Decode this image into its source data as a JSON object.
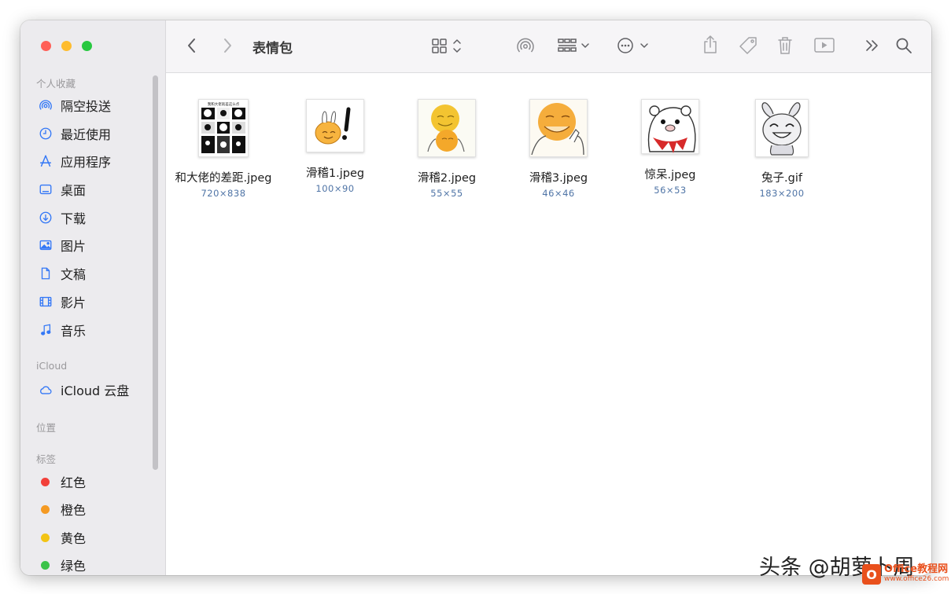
{
  "window": {
    "title": "表情包"
  },
  "colors": {
    "close": "#ff5f57",
    "minimize": "#febc2e",
    "zoom": "#28c840",
    "accent": "#3478f6"
  },
  "sidebar": {
    "favorites_title": "个人收藏",
    "favorites": [
      {
        "label": "隔空投送",
        "icon": "airdrop-icon"
      },
      {
        "label": "最近使用",
        "icon": "clock-icon"
      },
      {
        "label": "应用程序",
        "icon": "applications-icon"
      },
      {
        "label": "桌面",
        "icon": "desktop-icon"
      },
      {
        "label": "下载",
        "icon": "download-icon"
      },
      {
        "label": "图片",
        "icon": "photo-icon"
      },
      {
        "label": "文稿",
        "icon": "document-icon"
      },
      {
        "label": "影片",
        "icon": "film-icon"
      },
      {
        "label": "音乐",
        "icon": "music-icon"
      }
    ],
    "icloud_title": "iCloud",
    "icloud": [
      {
        "label": "iCloud 云盘",
        "icon": "cloud-icon"
      }
    ],
    "locations_title": "位置",
    "tags_title": "标签",
    "tags": [
      {
        "label": "红色",
        "color": "#f2403a"
      },
      {
        "label": "橙色",
        "color": "#f59a23"
      },
      {
        "label": "黄色",
        "color": "#f3c414"
      },
      {
        "label": "绿色",
        "color": "#3cc34a"
      }
    ]
  },
  "toolbar": {
    "back_icon": "chevron-left-icon",
    "forward_icon": "chevron-right-icon",
    "view_icon": "grid-view-icon",
    "airdrop_icon": "airdrop-icon",
    "group_icon": "group-icon",
    "more_icon": "ellipsis-circle-icon",
    "share_icon": "share-icon",
    "tag_icon": "tag-icon",
    "trash_icon": "trash-icon",
    "preview_icon": "play-icon",
    "overflow_icon": "double-chevron-icon",
    "search_icon": "search-icon"
  },
  "files": [
    {
      "name": "和大佬的差距.jpeg",
      "dims": "720×838"
    },
    {
      "name": "滑稽1.jpeg",
      "dims": "100×90"
    },
    {
      "name": "滑稽2.jpeg",
      "dims": "55×55"
    },
    {
      "name": "滑稽3.jpeg",
      "dims": "46×46"
    },
    {
      "name": "惊呆.jpeg",
      "dims": "56×53"
    },
    {
      "name": "兔子.gif",
      "dims": "183×200"
    }
  ],
  "thumb_texts": {
    "panda_caption": "我和大佬就差这么点"
  },
  "watermark": {
    "text": "头条 @胡萝卜周",
    "logo_letter": "O",
    "site_name": "Office教程网",
    "site_url": "www.office26.com"
  }
}
